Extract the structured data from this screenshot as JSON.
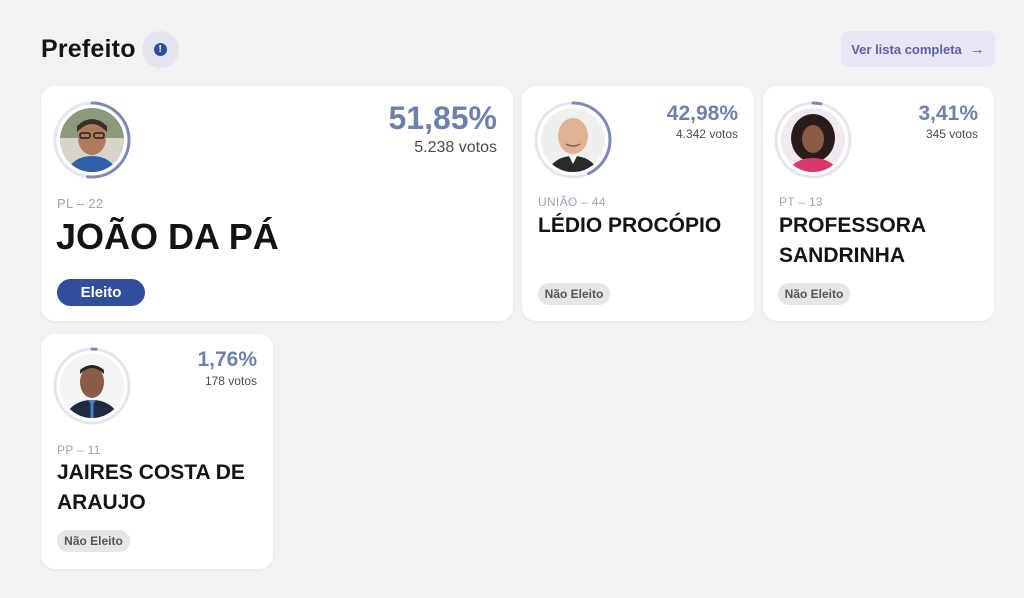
{
  "header": {
    "title": "Prefeito",
    "info_icon": "info-icon",
    "list_button_label": "Ver lista completa",
    "list_button_arrow": "→"
  },
  "candidates": [
    {
      "party": "PL – 22",
      "name": "JOÃO DA PÁ",
      "percent": "51,85%",
      "votes": "5.238 votos",
      "percent_value": 51.85,
      "status": "Eleito",
      "elected": true
    },
    {
      "party": "UNIÃO – 44",
      "name": "LÉDIO PROCÓPIO",
      "percent": "42,98%",
      "votes": "4.342 votos",
      "percent_value": 42.98,
      "status": "Não Eleito",
      "elected": false
    },
    {
      "party": "PT – 13",
      "name_line1": "PROFESSORA",
      "name_line2": "SANDRINHA",
      "percent": "3,41%",
      "votes": "345 votos",
      "percent_value": 3.41,
      "status": "Não Eleito",
      "elected": false
    },
    {
      "party": "PP – 11",
      "name_line1": "JAIRES COSTA DE",
      "name_line2": "ARAUJO",
      "percent": "1,76%",
      "votes": "178 votos",
      "percent_value": 1.76,
      "status": "Não Eleito",
      "elected": false
    }
  ],
  "colors": {
    "ring": "#7b8ab5",
    "ring_track": "#e3e6ef",
    "percent": "#6f80ad",
    "elected_badge": "#2f4f9d"
  }
}
